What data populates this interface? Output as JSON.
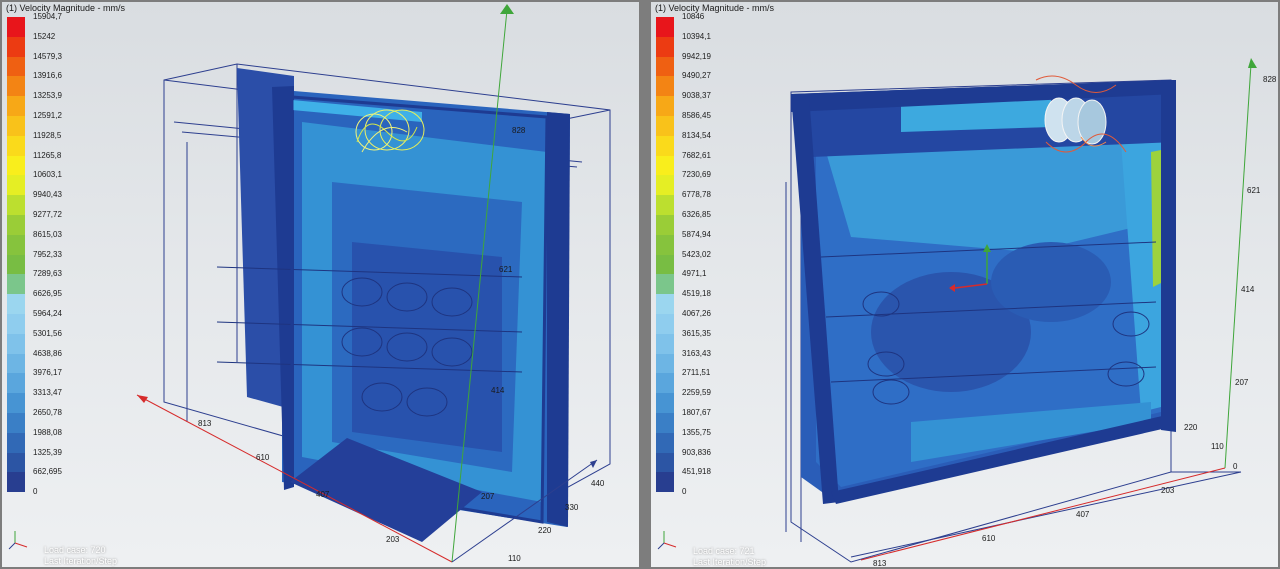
{
  "panels": [
    {
      "title": "(1) Velocity Magnitude - mm/s",
      "legend_values": [
        "15904,7",
        "15242",
        "14579,3",
        "13916,6",
        "13253,9",
        "12591,2",
        "11928,5",
        "11265,8",
        "10603,1",
        "9940,43",
        "9277,72",
        "8615,03",
        "7952,33",
        "7289,63",
        "6626,95",
        "5964,24",
        "5301,56",
        "4638,86",
        "3976,17",
        "3313,47",
        "2650,78",
        "1988,08",
        "1325,39",
        "662,695"
      ],
      "legend_zero": "0",
      "status": [
        "Load case: 720",
        "Last Iteration/Step"
      ],
      "dims": {
        "d813": "813",
        "d610": "610",
        "d407": "407",
        "d203": "203",
        "d828": "828",
        "d621": "621",
        "d414": "414",
        "d207": "207",
        "d440": "440",
        "d330": "330",
        "d220": "220",
        "d110": "110"
      }
    },
    {
      "title": "(1) Velocity Magnitude - mm/s",
      "legend_values": [
        "10846",
        "10394,1",
        "9942,19",
        "9490,27",
        "9038,37",
        "8586,45",
        "8134,54",
        "7682,61",
        "7230,69",
        "6778,78",
        "6326,85",
        "5874,94",
        "5423,02",
        "4971,1",
        "4519,18",
        "4067,26",
        "3615,35",
        "3163,43",
        "2711,51",
        "2259,59",
        "1807,67",
        "1355,75",
        "903,836",
        "451,918"
      ],
      "legend_zero": "0",
      "status": [
        "Load case: 721",
        "Last Iteration/Step"
      ],
      "dims": {
        "d828": "828",
        "d621": "621",
        "d414": "414",
        "d207": "207",
        "d0": "0",
        "d220": "220",
        "d110": "110",
        "d203": "203",
        "d407": "407",
        "d610": "610",
        "d813": "813"
      }
    }
  ],
  "colors": {
    "legend": [
      "#e8151b",
      "#ec3b12",
      "#ef6012",
      "#f38414",
      "#f7a817",
      "#f9c21a",
      "#fada1b",
      "#f9ee1c",
      "#e5ee24",
      "#bcdf2f",
      "#9acd37",
      "#86c33d",
      "#78bd43",
      "#7bc68b",
      "#9bd6ef",
      "#8fcdee",
      "#7fc2ea",
      "#6db5e4",
      "#5aa6dd",
      "#4794d3",
      "#3a7fc6",
      "#3169b6",
      "#2c55a4",
      "#283e90"
    ],
    "shell": "#1e3b92",
    "fill_light": "#3da9df",
    "fill_mid": "#2a74c4",
    "axis_green": "#3fa63a",
    "axis_red": "#d62b2b"
  }
}
